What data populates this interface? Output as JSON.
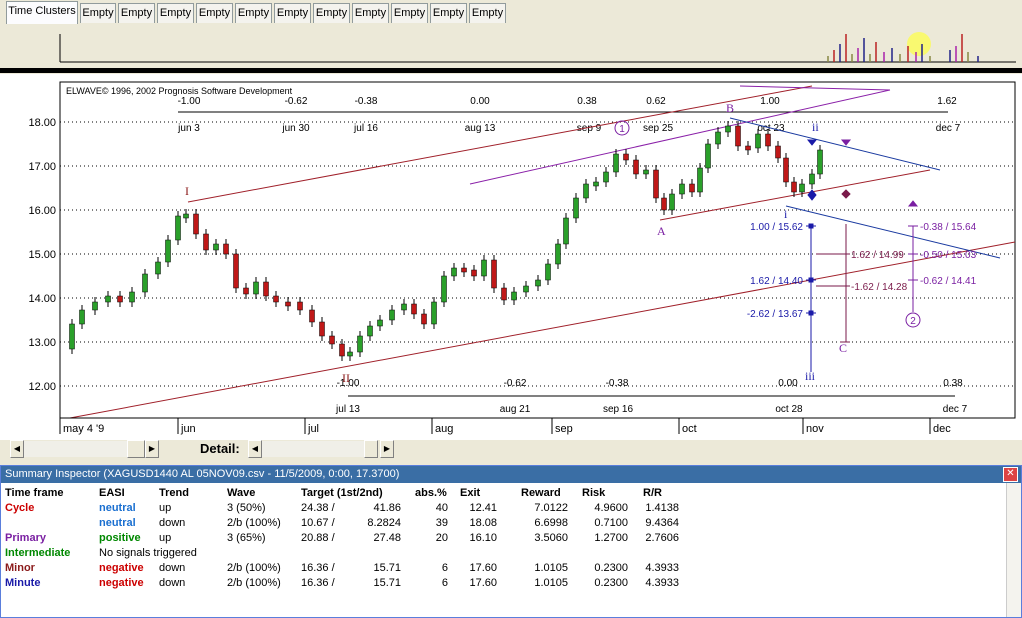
{
  "tabs": [
    "Time Clusters",
    "Empty",
    "Empty",
    "Empty",
    "Empty",
    "Empty",
    "Empty",
    "Empty",
    "Empty",
    "Empty",
    "Empty",
    "Empty",
    "Empty"
  ],
  "chart": {
    "copyright": "ELWAVE© 1996, 2002 Prognosis Software Development",
    "price_labels": [
      "18.00",
      "17.00",
      "16.00",
      "15.00",
      "14.00",
      "13.00",
      "12.00"
    ],
    "month_labels": [
      "may 4 '9",
      "jun",
      "jul",
      "aug",
      "sep",
      "oct",
      "nov",
      "dec"
    ],
    "top_ratios": [
      "-1.00",
      "-0.62",
      "-0.38",
      "0.00",
      "0.38",
      "0.62",
      "1.00",
      "1.62"
    ],
    "top_dates": [
      "jun 3",
      "jun 30",
      "jul 16",
      "aug 13",
      "sep 9",
      "sep 25",
      "oct 23",
      "dec 7"
    ],
    "bottom_ratios": [
      "-1.00",
      "-0.62",
      "-0.38",
      "0.00",
      "0.38"
    ],
    "bottom_dates": [
      "jul 13",
      "aug 21",
      "sep 16",
      "oct 28",
      "dec 7"
    ],
    "wave_labels": [
      "I",
      "II",
      "A",
      "B",
      "C",
      "i",
      "ii",
      "iii",
      "1",
      "2"
    ],
    "target_labels_blue": [
      "1.00 / 15.62",
      "1.62 / 14.40",
      "-2.62 / 13.67"
    ],
    "target_labels_brown": [
      "1.62 / 14.99",
      "-1.62 / 14.28"
    ],
    "target_labels_purple": [
      "-0.38 / 15.64",
      "-0.50 / 15.03",
      "-0.62 / 14.41"
    ]
  },
  "scroll": {
    "detail_label": "Detail:"
  },
  "summary": {
    "title": "Summary Inspector (XAGUSD1440 AL 05NOV09.csv - 11/5/2009, 0:00, 17.3700)",
    "headers": [
      "Time frame",
      "EASI",
      "Trend",
      "Wave",
      "Target (1st/2nd)",
      "abs.%",
      "Exit",
      "Reward",
      "Risk",
      "R/R"
    ],
    "rows": [
      {
        "tf": "Cycle",
        "tf_color": "#cc0000",
        "easi": "neutral",
        "easi_color": "#1a6fd0",
        "trend": "up",
        "wave": "3 (50%)",
        "t1": "24.38 /",
        "t2": "41.86",
        "abs": "40",
        "exit": "12.41",
        "reward": "7.0122",
        "risk": "4.9600",
        "rr": "1.4138"
      },
      {
        "tf": "",
        "tf_color": "#000",
        "easi": "neutral",
        "easi_color": "#1a6fd0",
        "trend": "down",
        "wave": "2/b (100%)",
        "t1": "10.67 /",
        "t2": "8.2824",
        "abs": "39",
        "exit": "18.08",
        "reward": "6.6998",
        "risk": "0.7100",
        "rr": "9.4364"
      },
      {
        "tf": "Primary",
        "tf_color": "#7a1fa2",
        "easi": "positive",
        "easi_color": "#008800",
        "trend": "up",
        "wave": "3 (65%)",
        "t1": "20.88 /",
        "t2": "27.48",
        "abs": "20",
        "exit": "16.10",
        "reward": "3.5060",
        "risk": "1.2700",
        "rr": "2.7606"
      },
      {
        "tf": "Intermediate",
        "tf_color": "#008800",
        "easi": "No signals triggered",
        "easi_color": "#000",
        "trend": "",
        "wave": "",
        "t1": "",
        "t2": "",
        "abs": "",
        "exit": "",
        "reward": "",
        "risk": "",
        "rr": ""
      },
      {
        "tf": "Minor",
        "tf_color": "#8b1a1a",
        "easi": "negative",
        "easi_color": "#cc0000",
        "trend": "down",
        "wave": "2/b (100%)",
        "t1": "16.36 /",
        "t2": "15.71",
        "abs": "6",
        "exit": "17.60",
        "reward": "1.0105",
        "risk": "0.2300",
        "rr": "4.3933"
      },
      {
        "tf": "Minute",
        "tf_color": "#1a1aa8",
        "easi": "negative",
        "easi_color": "#cc0000",
        "trend": "down",
        "wave": "2/b (100%)",
        "t1": "16.36 /",
        "t2": "15.71",
        "abs": "6",
        "exit": "17.60",
        "reward": "1.0105",
        "risk": "0.2300",
        "rr": "4.3933"
      }
    ]
  }
}
